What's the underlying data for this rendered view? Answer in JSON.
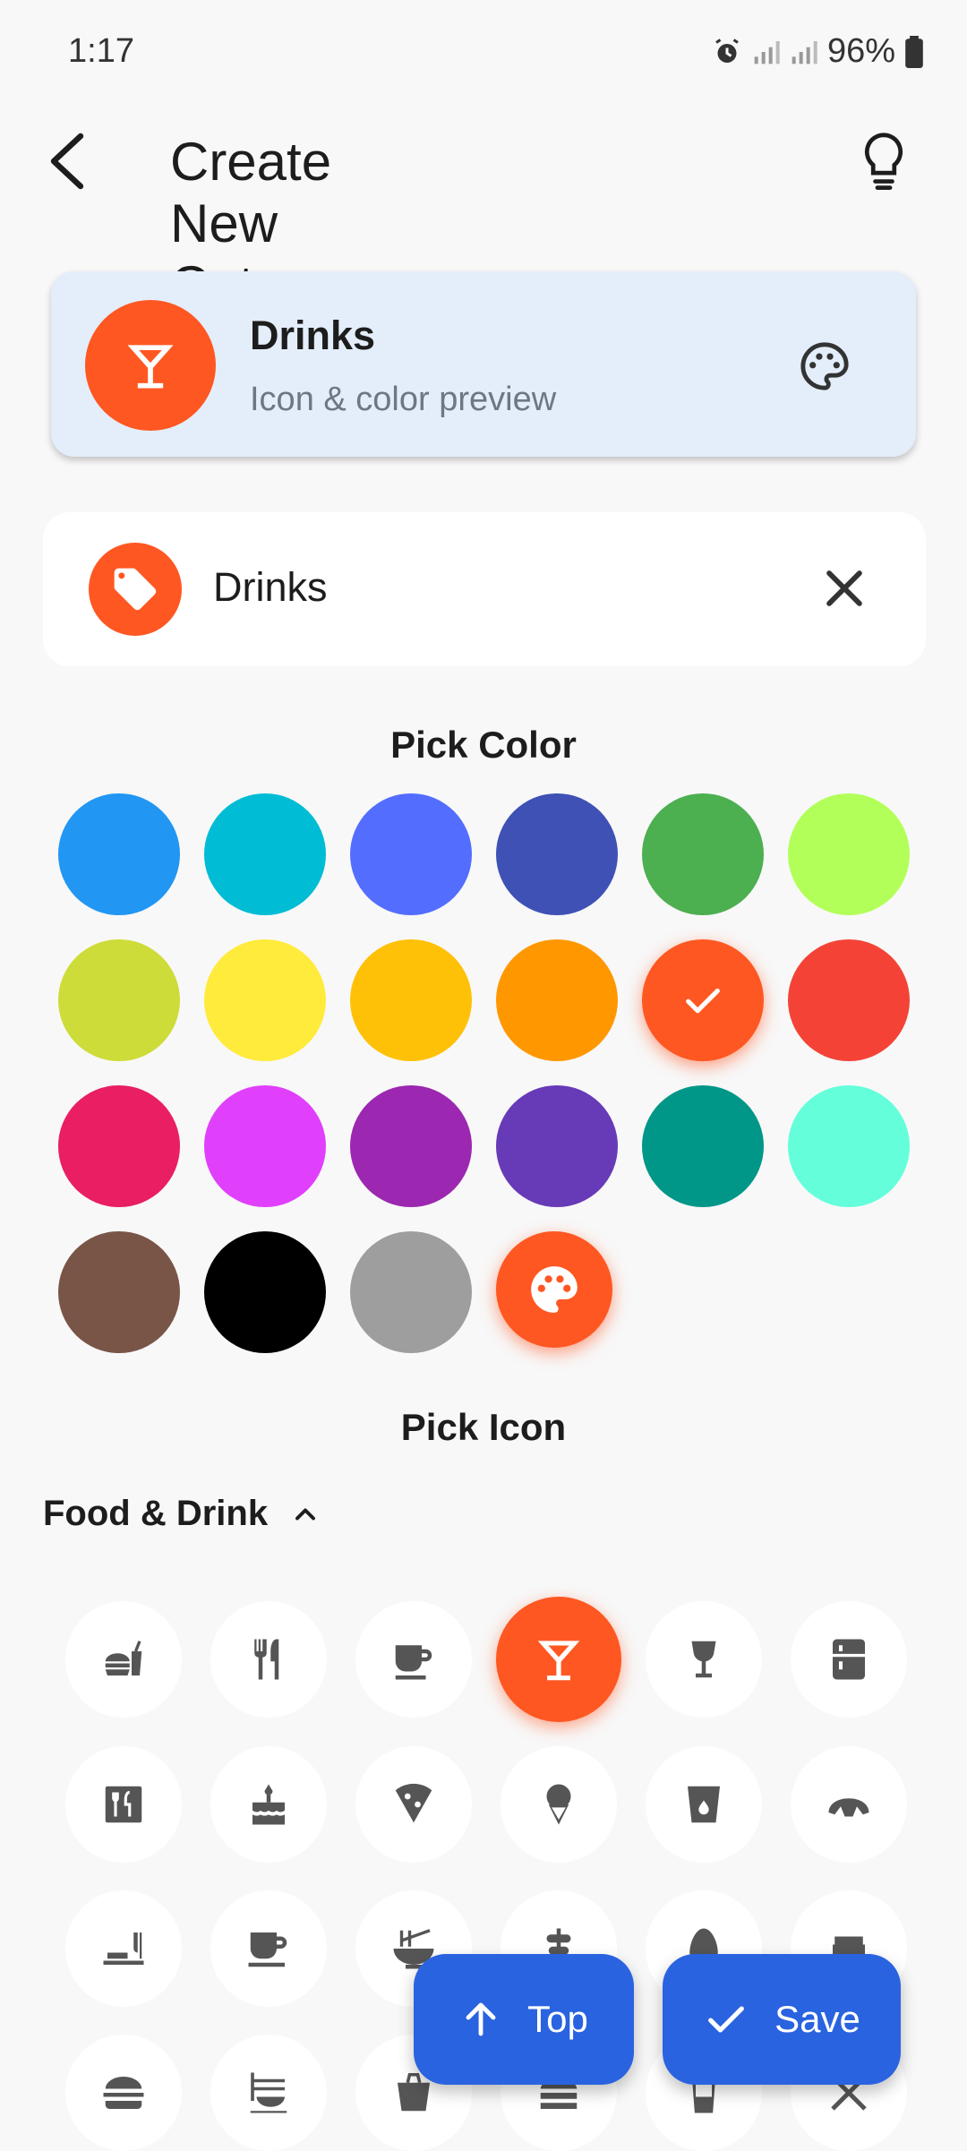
{
  "status_bar": {
    "time": "1:17",
    "battery": "96%"
  },
  "app_bar": {
    "title": "Create New Category"
  },
  "preview": {
    "name": "Drinks",
    "subtitle": "Icon & color preview"
  },
  "name_field": {
    "value": "Drinks"
  },
  "color_section": {
    "title": "Pick Color",
    "colors": [
      "#2196f3",
      "#00bcd4",
      "#536dfe",
      "#3f51b5",
      "#4caf50",
      "#b2ff59",
      "#cddc39",
      "#ffeb3b",
      "#ffc107",
      "#ff9800",
      "#ff5722",
      "#f44336",
      "#e91e63",
      "#e040fb",
      "#9c27b0",
      "#673ab7",
      "#009688",
      "#64ffda",
      "#795548",
      "#000000",
      "#9e9e9e"
    ],
    "selected_color": "#ff5722",
    "custom_picker_icon": "palette-icon"
  },
  "icon_section": {
    "title": "Pick Icon",
    "category": "Food & Drink",
    "selected_icon": "cocktail-icon",
    "icons": [
      "fastfood-icon",
      "restaurant-icon",
      "coffee-icon",
      "cocktail-icon",
      "wine-glass-icon",
      "kitchen-icon",
      "restaurant-menu-icon",
      "cake-icon",
      "pizza-icon",
      "icecream-icon",
      "water-glass-icon",
      "bakery-icon",
      "dining-icon",
      "cafe-icon",
      "ramen-icon",
      "kebab-icon",
      "egg-icon",
      "toaster-icon",
      "burger-icon",
      "ramen-dining-icon",
      "takeout-icon",
      "lunch-icon",
      "soda-icon",
      "no-food-icon"
    ]
  },
  "fabs": {
    "top_label": "Top",
    "save_label": "Save"
  }
}
